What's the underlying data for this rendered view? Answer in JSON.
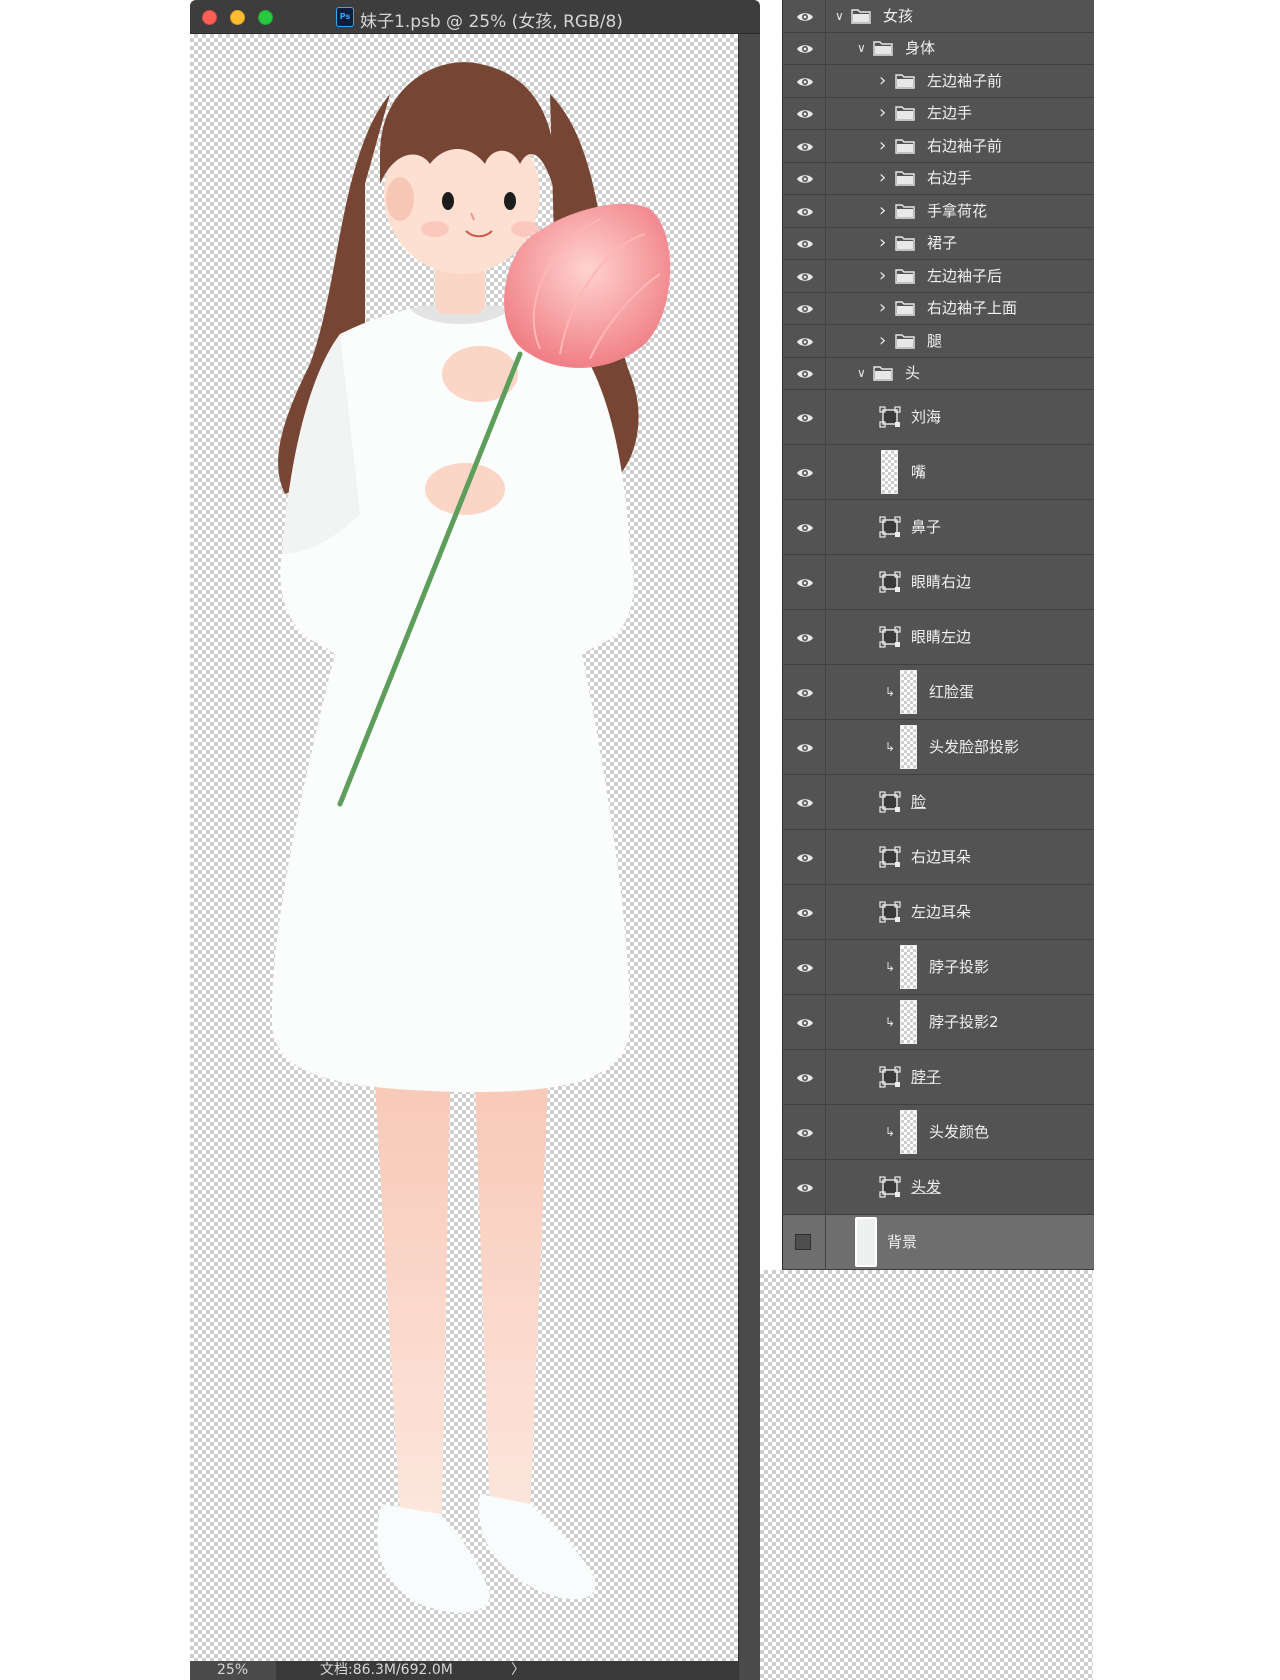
{
  "document": {
    "title": "妹子1.psb @ 25% (女孩, RGB/8)",
    "app_icon": "Ps",
    "zoom": "25%",
    "doc_size": "文档:86.3M/692.0M",
    "status_arrow": "〉"
  },
  "layers_panel": {
    "rows": [
      {
        "name": "女孩",
        "kind": "group",
        "expanded": true,
        "indent": 0,
        "visible": true
      },
      {
        "name": "身体",
        "kind": "group",
        "expanded": true,
        "indent": 1,
        "visible": true
      },
      {
        "name": "左边袖子前",
        "kind": "group",
        "expanded": false,
        "indent": 2,
        "visible": true
      },
      {
        "name": "左边手",
        "kind": "group",
        "expanded": false,
        "indent": 2,
        "visible": true
      },
      {
        "name": "右边袖子前",
        "kind": "group",
        "expanded": false,
        "indent": 2,
        "visible": true
      },
      {
        "name": "右边手",
        "kind": "group",
        "expanded": false,
        "indent": 2,
        "visible": true
      },
      {
        "name": "手拿荷花",
        "kind": "group",
        "expanded": false,
        "indent": 2,
        "visible": true
      },
      {
        "name": "裙子",
        "kind": "group",
        "expanded": false,
        "indent": 2,
        "visible": true
      },
      {
        "name": "左边袖子后",
        "kind": "group",
        "expanded": false,
        "indent": 2,
        "visible": true
      },
      {
        "name": "右边袖子上面",
        "kind": "group",
        "expanded": false,
        "indent": 2,
        "visible": true
      },
      {
        "name": "腿",
        "kind": "group",
        "expanded": false,
        "indent": 2,
        "visible": true
      },
      {
        "name": "头",
        "kind": "group",
        "expanded": true,
        "indent": 1,
        "visible": true
      },
      {
        "name": "刘海",
        "kind": "smart",
        "visible": true
      },
      {
        "name": "嘴",
        "kind": "pixel",
        "visible": true
      },
      {
        "name": "鼻子",
        "kind": "smart",
        "visible": true
      },
      {
        "name": "眼睛右边",
        "kind": "smart",
        "visible": true
      },
      {
        "name": "眼睛左边",
        "kind": "smart",
        "visible": true
      },
      {
        "name": "红脸蛋",
        "kind": "clipped",
        "visible": true
      },
      {
        "name": "头发脸部投影",
        "kind": "clipped",
        "visible": true
      },
      {
        "name": "脸",
        "kind": "smart",
        "visible": true,
        "underline": true
      },
      {
        "name": "右边耳朵",
        "kind": "smart",
        "visible": true
      },
      {
        "name": "左边耳朵",
        "kind": "smart",
        "visible": true
      },
      {
        "name": "脖子投影",
        "kind": "clipped",
        "visible": true
      },
      {
        "name": "脖子投影2",
        "kind": "clipped",
        "visible": true
      },
      {
        "name": "脖子",
        "kind": "smart",
        "visible": true,
        "underline": true
      },
      {
        "name": "头发颜色",
        "kind": "clipped",
        "visible": true
      },
      {
        "name": "头发",
        "kind": "smart",
        "visible": true,
        "underline": true
      },
      {
        "name": "背景",
        "kind": "background",
        "visible": false,
        "selected": true
      }
    ]
  },
  "colors": {
    "panel_bg": "#535353",
    "selected_row": "#6e6e6e",
    "ps_blue": "#31a8ff",
    "close": "#ff5f57",
    "minimize": "#febc2e",
    "maximize": "#28c840"
  },
  "icons": {
    "visibility": "eye-icon",
    "group": "folder-icon",
    "smart_object": "smart-object-icon",
    "clip": "clipping-arrow-icon"
  }
}
